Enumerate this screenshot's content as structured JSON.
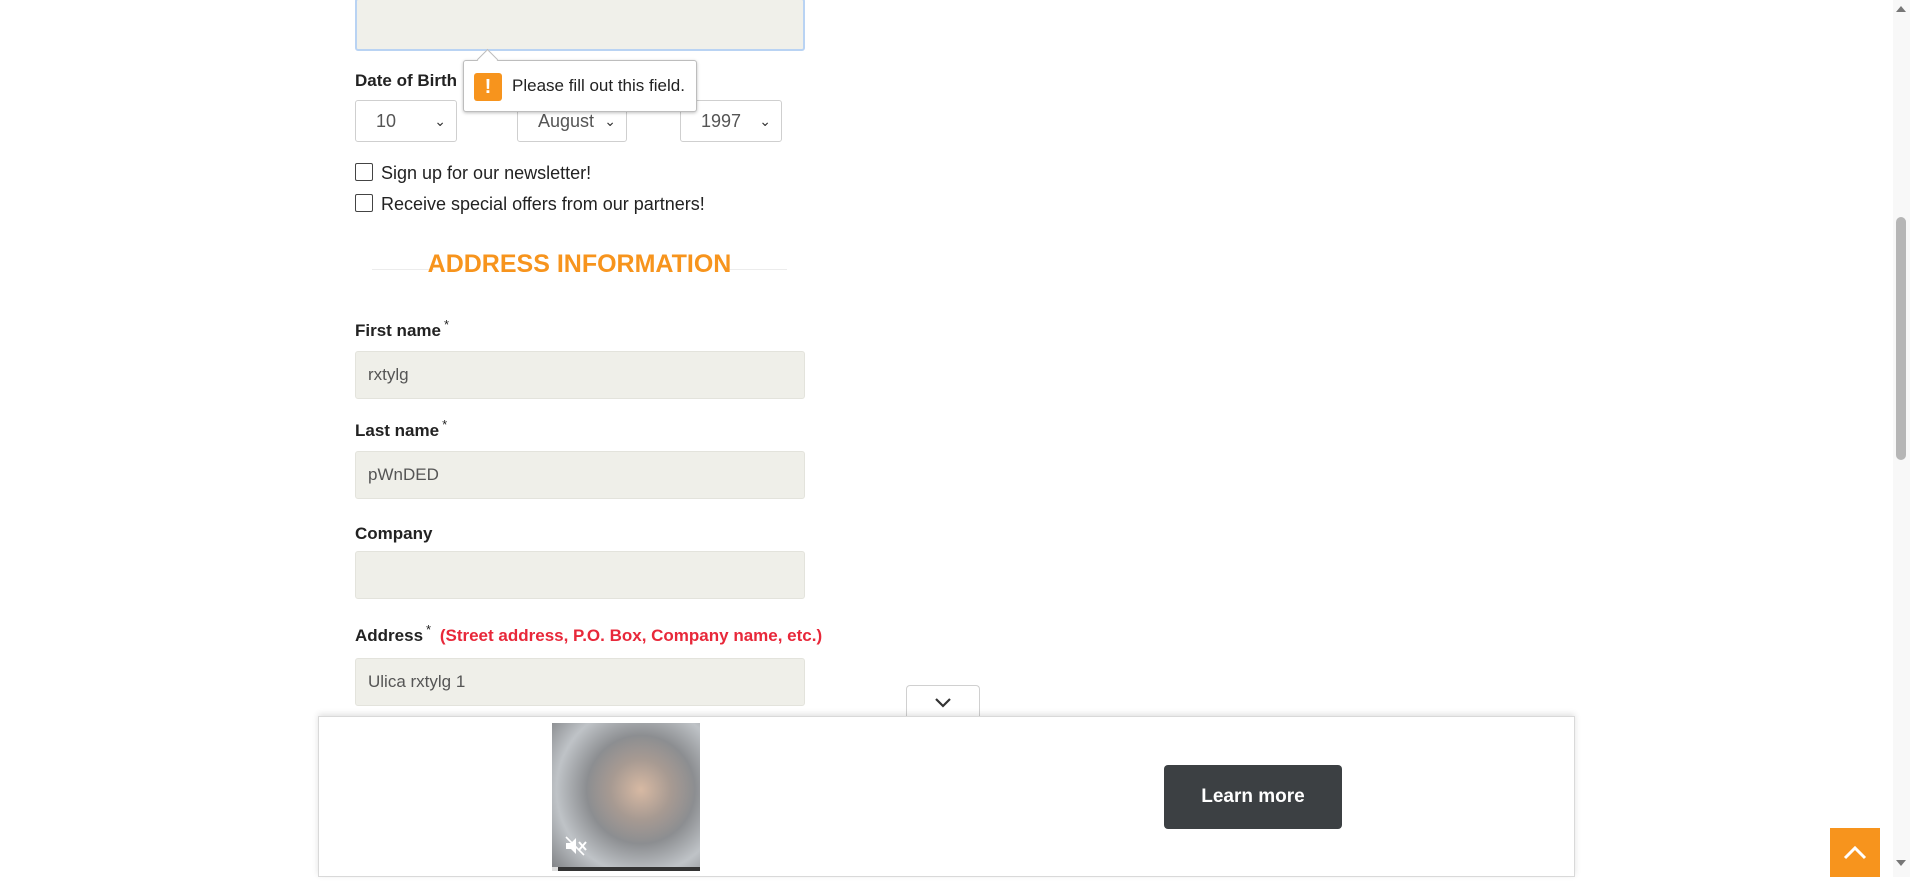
{
  "form": {
    "dob_label": "Date of Birth",
    "dob_day": "10",
    "dob_month": "August",
    "dob_year": "1997",
    "newsletter_label": "Sign up for our newsletter!",
    "offers_label": "Receive special offers from our partners!"
  },
  "validation": {
    "tooltip_text": "Please fill out this field."
  },
  "address": {
    "section_title": "ADDRESS INFORMATION",
    "first_name_label": "First name",
    "first_name_value": "rxtylg",
    "last_name_label": "Last name",
    "last_name_value": "pWnDED",
    "company_label": "Company",
    "company_value": "",
    "address_label": "Address",
    "address_hint": "(Street address, P.O. Box, Company name, etc.)",
    "address_value": "Ulica rxtylg 1",
    "required_mark": "*"
  },
  "ad": {
    "learn_more": "Learn more",
    "video_progress": 0.04
  },
  "colors": {
    "accent": "#f7941d",
    "hint_red": "#e8283a",
    "button_dark": "#3c4043"
  },
  "icons": {
    "warning": "warning-icon",
    "mute": "muted-speaker-icon",
    "collapse": "chevron-down-icon",
    "to_top": "chevron-up-icon"
  }
}
